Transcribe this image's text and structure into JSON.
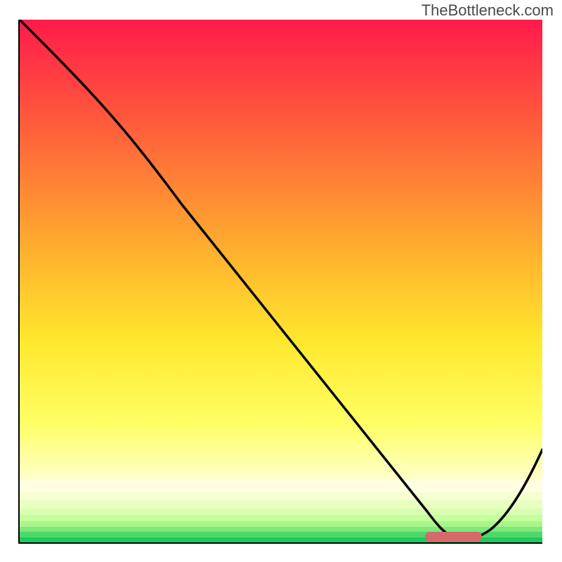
{
  "attribution": "TheBottleneck.com",
  "chart_data": {
    "type": "line",
    "title": "",
    "xlabel": "",
    "ylabel": "",
    "xlim": [
      0,
      100
    ],
    "ylim": [
      0,
      100
    ],
    "x": [
      0,
      5,
      10,
      15,
      20,
      25,
      30,
      35,
      40,
      45,
      50,
      55,
      60,
      65,
      70,
      75,
      78,
      80,
      82,
      85,
      88,
      92,
      96,
      100
    ],
    "values": [
      100,
      95,
      90,
      84,
      78,
      72,
      67,
      59,
      51,
      44,
      37,
      30,
      24,
      18,
      12,
      6,
      3,
      1.5,
      0.8,
      0.5,
      1,
      4,
      10,
      18
    ],
    "background_gradient_stops": [
      {
        "pos": 0.0,
        "color": "#ff1a4b"
      },
      {
        "pos": 0.2,
        "color": "#ff5a3c"
      },
      {
        "pos": 0.45,
        "color": "#ffb22e"
      },
      {
        "pos": 0.62,
        "color": "#ffe82e"
      },
      {
        "pos": 0.78,
        "color": "#ffff66"
      },
      {
        "pos": 0.88,
        "color": "#ffffcc"
      }
    ],
    "bottom_bands": [
      {
        "from": 0.88,
        "to": 0.905,
        "color": "#ffffe0"
      },
      {
        "from": 0.905,
        "to": 0.92,
        "color": "#f5ffd0"
      },
      {
        "from": 0.92,
        "to": 0.935,
        "color": "#e8ffc0"
      },
      {
        "from": 0.935,
        "to": 0.948,
        "color": "#d8ffb0"
      },
      {
        "from": 0.948,
        "to": 0.96,
        "color": "#c4ff9c"
      },
      {
        "from": 0.96,
        "to": 0.97,
        "color": "#a8f58c"
      },
      {
        "from": 0.97,
        "to": 0.98,
        "color": "#7ee87a"
      },
      {
        "from": 0.98,
        "to": 0.99,
        "color": "#4fd86a"
      },
      {
        "from": 0.99,
        "to": 1.0,
        "color": "#1ec95e"
      }
    ],
    "minimum_marker": {
      "x_from": 78,
      "x_to": 88,
      "y": 0.5
    }
  }
}
